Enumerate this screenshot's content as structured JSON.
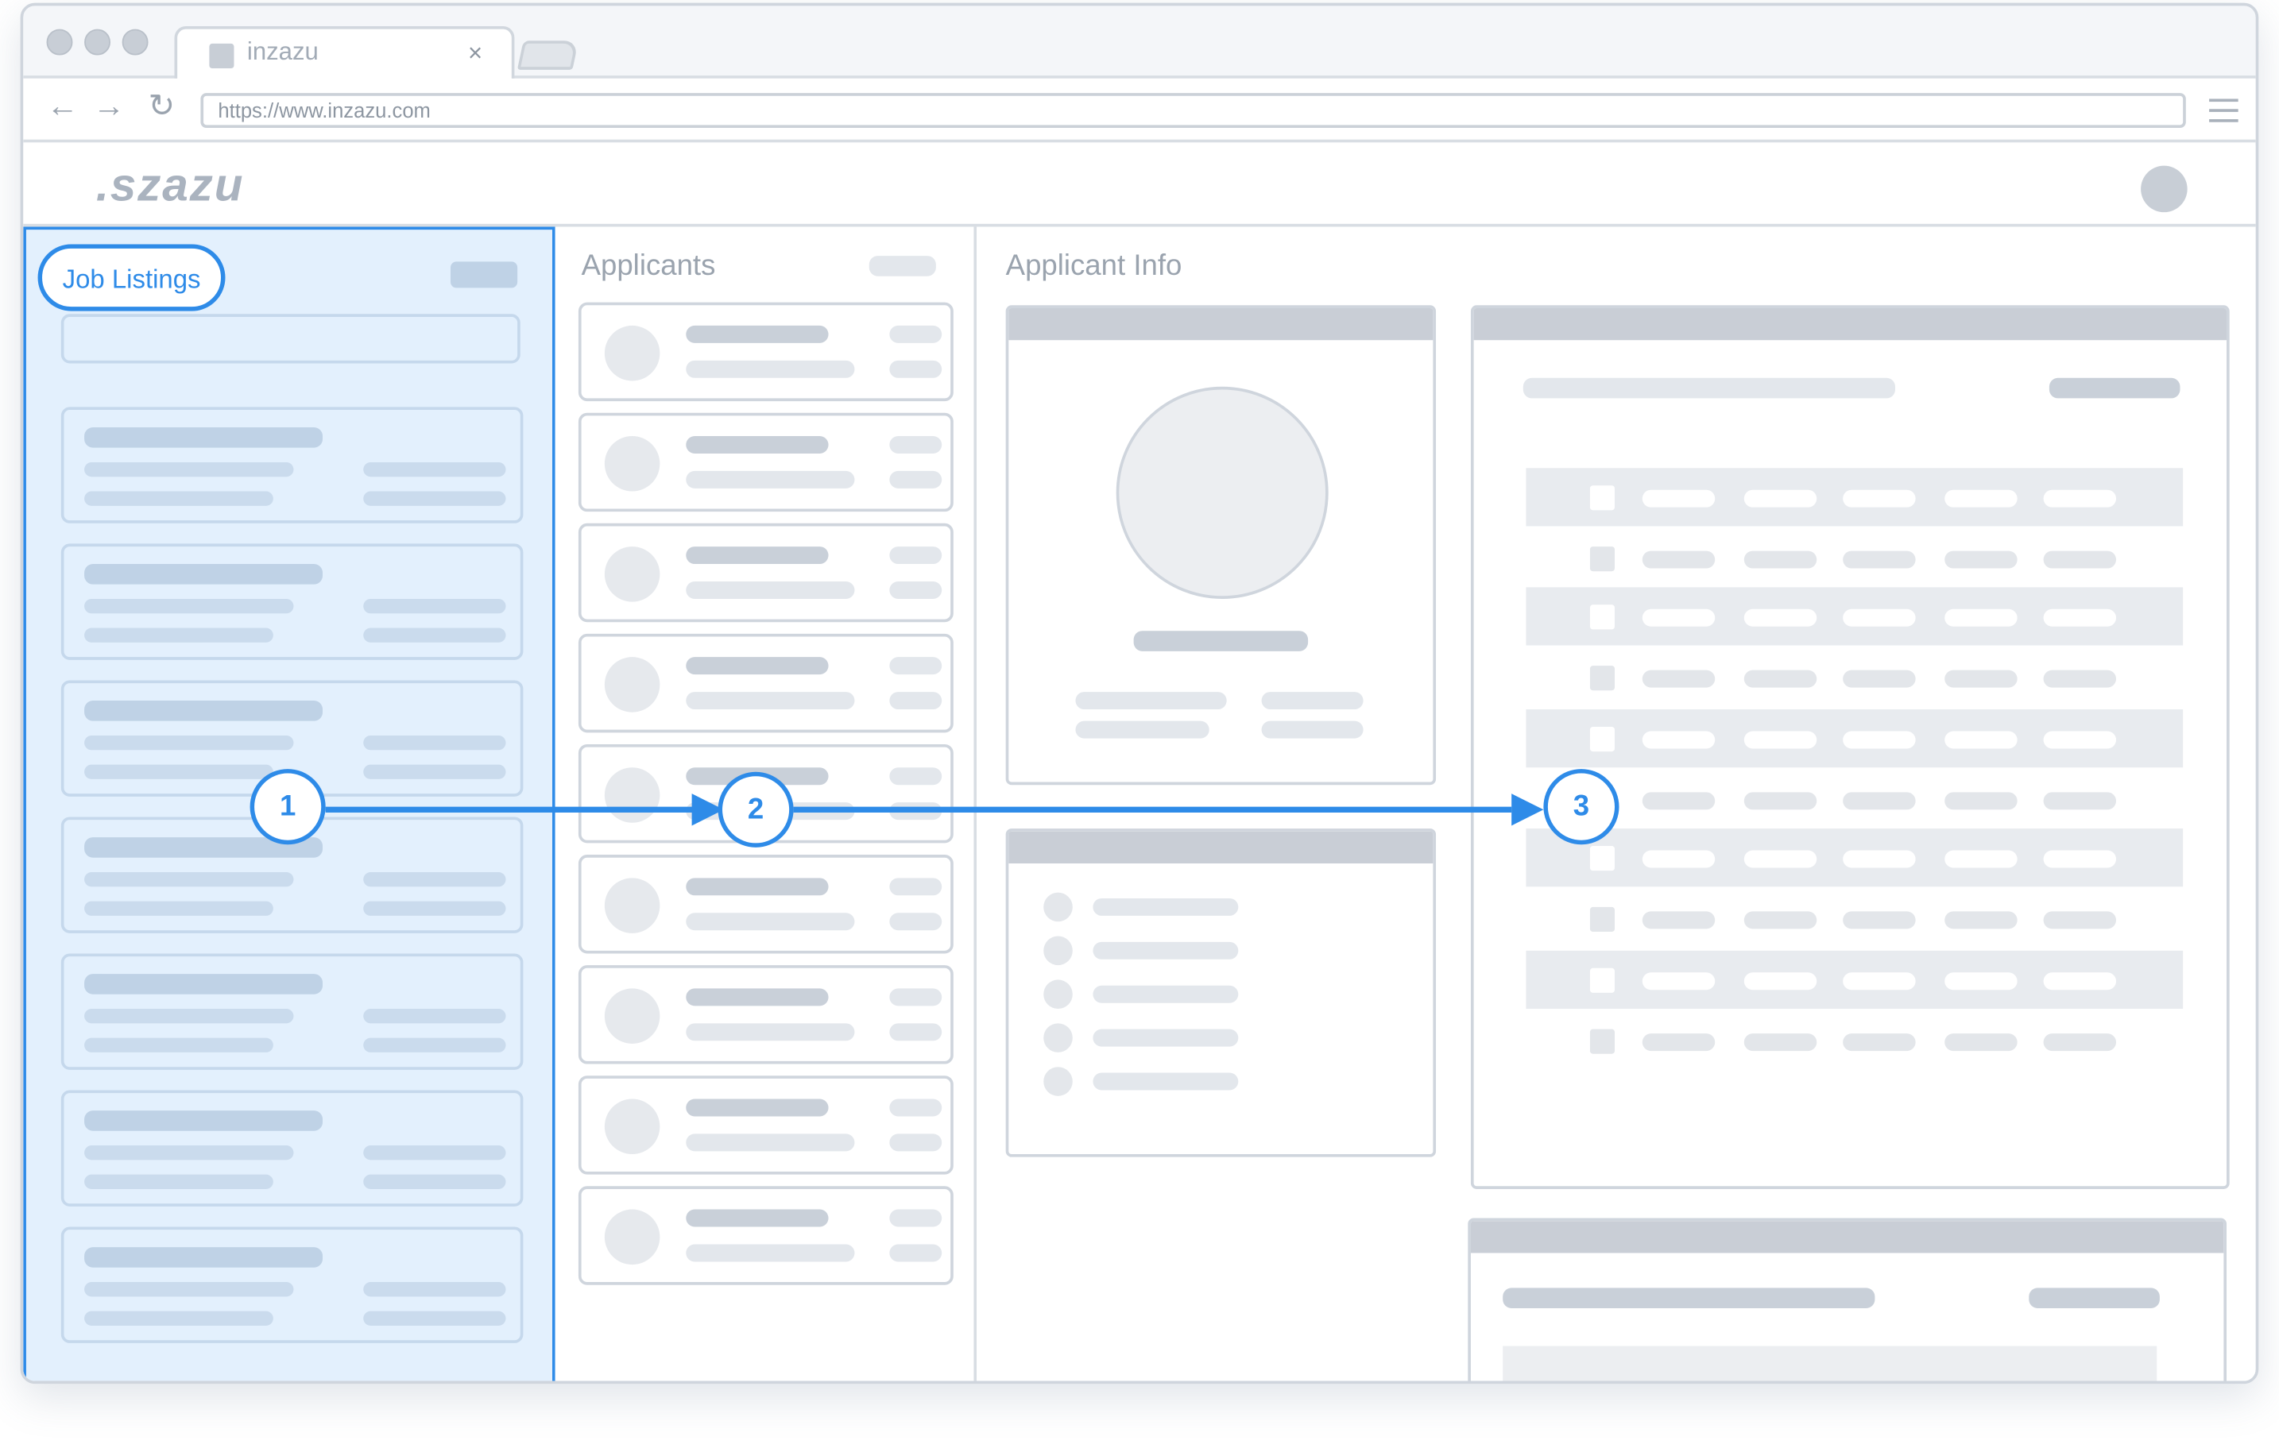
{
  "browser": {
    "tab_title": "inzazu",
    "tab_close": "×",
    "url": "https://www.inzazu.com",
    "icons": [
      "back-arrow-icon",
      "forward-arrow-icon",
      "reload-icon",
      "menu-icon"
    ]
  },
  "app": {
    "logo": ".szazu"
  },
  "job_panel": {
    "title": "Job Listings"
  },
  "applicants_panel": {
    "title": "Applicants"
  },
  "info_panel": {
    "title": "Applicant Info"
  },
  "flow": {
    "steps": [
      "1",
      "2",
      "3"
    ],
    "accent_color": "#2e8be8"
  }
}
